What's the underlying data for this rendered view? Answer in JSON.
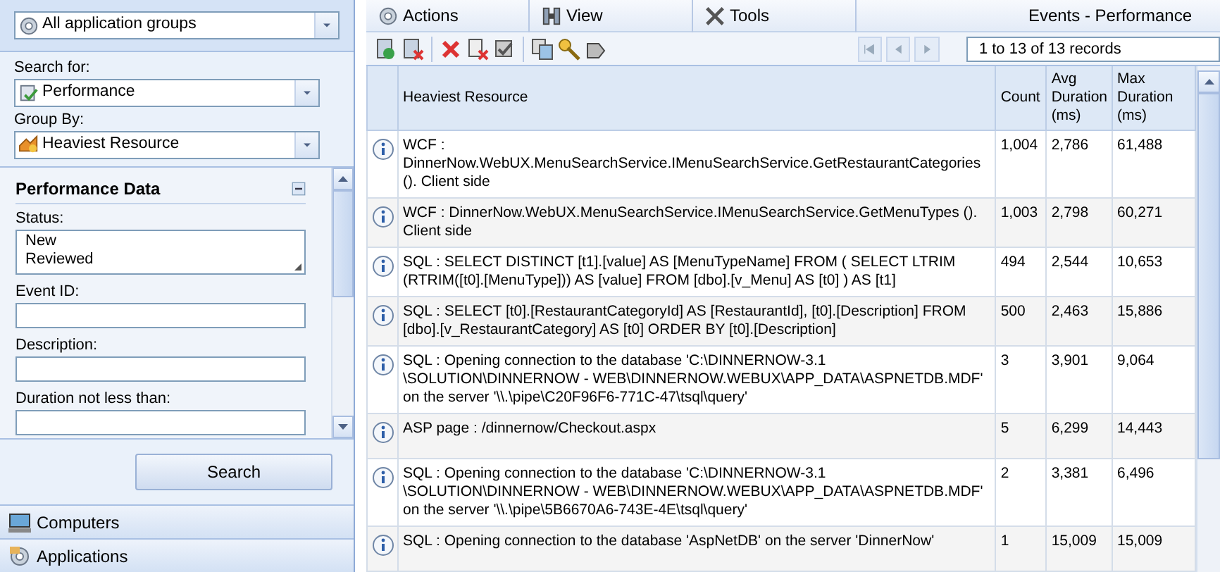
{
  "app_group_select": {
    "value": "All application groups"
  },
  "search_for": {
    "label": "Search for:",
    "value": "Performance"
  },
  "group_by": {
    "label": "Group By:",
    "value": "Heaviest Resource"
  },
  "filter_panel": {
    "title": "Performance Data",
    "expanded": true,
    "fields": [
      {
        "kind": "list",
        "label": "Status:",
        "lines": [
          "New",
          "Reviewed"
        ]
      },
      {
        "kind": "text",
        "label": "Event ID:"
      },
      {
        "kind": "text",
        "label": "Description:"
      },
      {
        "kind": "text",
        "label": "Duration not less than:"
      }
    ]
  },
  "search_button": "Search",
  "nav_sections": [
    {
      "label": "Computers"
    },
    {
      "label": "Applications"
    }
  ],
  "menu": [
    {
      "label": "Actions"
    },
    {
      "label": "View"
    },
    {
      "label": "Tools"
    }
  ],
  "view_title": "Events - Performance",
  "pager": {
    "records": "1 to 13 of 13 records"
  },
  "table": {
    "columns": [
      "Heaviest Resource",
      "Count",
      "Avg Duration (ms)",
      "Max Duration (ms)"
    ],
    "rows": [
      {
        "cells": [
          "WCF : DinnerNow.WebUX.MenuSearchService.IMenuSearchService.GetRestaurantCategories (). Client side",
          "1,004",
          "2,786",
          "61,488"
        ]
      },
      {
        "cells": [
          "WCF : DinnerNow.WebUX.MenuSearchService.IMenuSearchService.GetMenuTypes (). Client side",
          "1,003",
          "2,798",
          "60,271"
        ]
      },
      {
        "cells": [
          "SQL : SELECT DISTINCT [t1].[value] AS [MenuTypeName] FROM ( SELECT LTRIM (RTRIM([t0].[MenuType])) AS [value] FROM [dbo].[v_Menu] AS [t0] ) AS [t1]",
          "494",
          "2,544",
          "10,653"
        ]
      },
      {
        "cells": [
          "SQL : SELECT [t0].[RestaurantCategoryId] AS [RestaurantId], [t0].[Description] FROM [dbo].[v_RestaurantCategory] AS [t0] ORDER BY [t0].[Description]",
          "500",
          "2,463",
          "15,886"
        ]
      },
      {
        "cells": [
          "SQL : Opening connection to the database 'C:\\DINNERNOW-3.1 \\SOLUTION\\DINNERNOW - WEB\\DINNERNOW.WEBUX\\APP_DATA\\ASPNETDB.MDF' on the server '\\\\.\\pipe\\C20F96F6-771C-47\\tsql\\query'",
          "3",
          "3,901",
          "9,064"
        ]
      },
      {
        "cells": [
          "ASP page : /dinnernow/Checkout.aspx",
          "5",
          "6,299",
          "14,443"
        ]
      },
      {
        "cells": [
          "SQL : Opening connection to the database 'C:\\DINNERNOW-3.1 \\SOLUTION\\DINNERNOW - WEB\\DINNERNOW.WEBUX\\APP_DATA\\ASPNETDB.MDF' on the server '\\\\.\\pipe\\5B6670A6-743E-4E\\tsql\\query'",
          "2",
          "3,381",
          "6,496"
        ]
      },
      {
        "cells": [
          "SQL : Opening connection to the database 'AspNetDB' on the server 'DinnerNow'",
          "1",
          "15,009",
          "15,009"
        ]
      }
    ]
  }
}
